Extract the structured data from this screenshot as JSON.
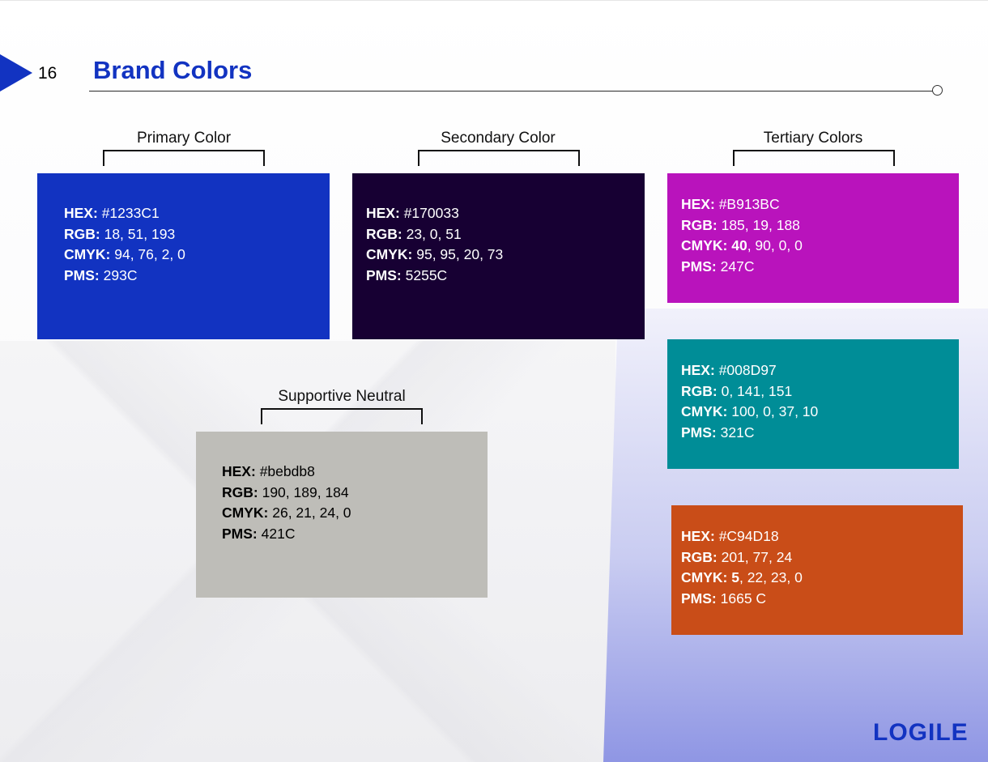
{
  "slide": {
    "page_number": "16",
    "title": "Brand Colors",
    "logo": "LOGILE"
  },
  "labels": {
    "primary": "Primary Color",
    "secondary": "Secondary Color",
    "tertiary": "Tertiary Colors",
    "neutral": "Supportive Neutral"
  },
  "spec_keys": {
    "hex": "HEX:",
    "rgb": "RGB:",
    "cmyk": "CMYK:",
    "pms": "PMS:"
  },
  "swatches": {
    "primary": {
      "color": "#1233C1",
      "hex": "#1233C1",
      "rgb": "18, 51, 193",
      "cmyk": "94, 76, 2, 0",
      "pms": "293C"
    },
    "secondary": {
      "color": "#170033",
      "hex": "#170033",
      "rgb": "23, 0, 51",
      "cmyk": "95, 95, 20, 73",
      "pms": "5255C"
    },
    "tertiary_magenta": {
      "color": "#B913BC",
      "hex": "#B913BC",
      "rgb": "185, 19, 188",
      "cmyk_lead": "40",
      "cmyk_rest": ", 90, 0, 0",
      "pms": "247C"
    },
    "tertiary_teal": {
      "color": "#008D97",
      "hex": "#008D97",
      "rgb": "0, 141, 151",
      "cmyk": "100, 0, 37, 10",
      "pms": "321C"
    },
    "tertiary_orange": {
      "color": "#C94D18",
      "hex": "#C94D18",
      "rgb": "201, 77, 24",
      "cmyk_lead": "5",
      "cmyk_rest": ", 22, 23, 0",
      "pms": "1665 C"
    },
    "neutral": {
      "color": "#BEBDB8",
      "hex": "#bebdb8",
      "rgb": "190, 189, 184",
      "cmyk": "26, 21, 24, 0",
      "pms": "421C"
    }
  },
  "colors": {
    "accent": "#1233C1",
    "background_gradient_bottom": "#8F96E4"
  }
}
